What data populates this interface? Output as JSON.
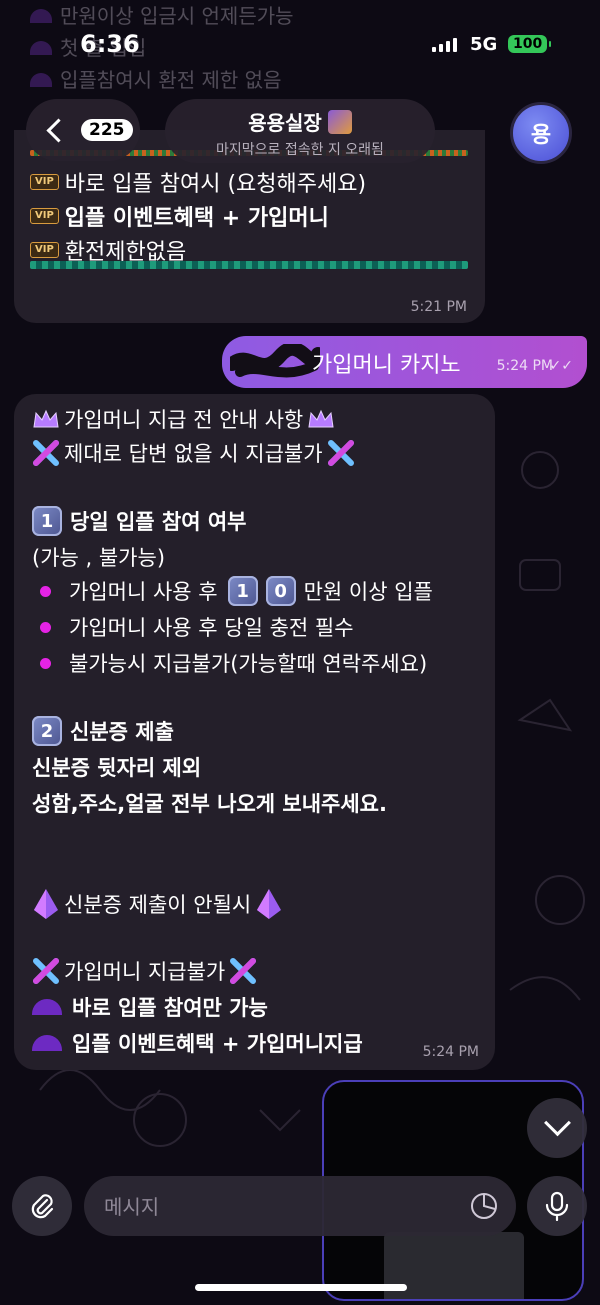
{
  "status_bar": {
    "time": "6:36",
    "network": "5G",
    "battery": "100"
  },
  "header": {
    "back_count": "225",
    "title": "용용실장",
    "subtitle": "마지막으로 접속한 지 오래됨",
    "avatar_letter": "용"
  },
  "faded_top": [
    "만원이상 입금시 언제든가능",
    "첫 출 입입",
    "입플참여시 환전 제한 없음"
  ],
  "messages": [
    {
      "side": "incoming",
      "lines": [
        "바로 입플 참여시 (요청해주세요)",
        "입플 이벤트혜택 + 가입머니",
        "환전제한없음"
      ],
      "badge": "VIP",
      "time": "5:21 PM"
    },
    {
      "side": "outgoing",
      "text": "가입머니 카지노",
      "time": "5:24 PM"
    },
    {
      "side": "incoming",
      "title": "가입머니 지급 전 안내 사항",
      "warning": "제대로 답변 없을 시 지급불가",
      "section1_num": "1",
      "section1_title": "당일 입플 참여 여부",
      "section1_options": "(가능 , 불가능)",
      "bullet1_a": "가입머니 사용 후",
      "bullet1_num1": "1",
      "bullet1_num2": "0",
      "bullet1_b": "만원 이상 입플",
      "bullet2": "가입머니 사용 후 당일 충전 필수",
      "bullet3": "불가능시 지급불가(가능할때 연락주세요)",
      "section2_num": "2",
      "section2_title": "신분증 제출",
      "section2_line1": "신분증 뒷자리 제외",
      "section2_line2": "성함,주소,얼굴 전부 나오게 보내주세요.",
      "crystal_line": "신분증 제출이 안될시",
      "final_x": "가입머니 지급불가",
      "final_1": "바로 입플 참여만 가능",
      "final_2": "입플 이벤트혜택 + 가입머니지급",
      "time": "5:24 PM"
    }
  ],
  "composer": {
    "placeholder": "메시지"
  },
  "colors": {
    "outgoing_start": "#8e5be3",
    "outgoing_end": "#b24fd0",
    "bullet": "#e523e5",
    "incoming_bg": "#241f2a"
  }
}
